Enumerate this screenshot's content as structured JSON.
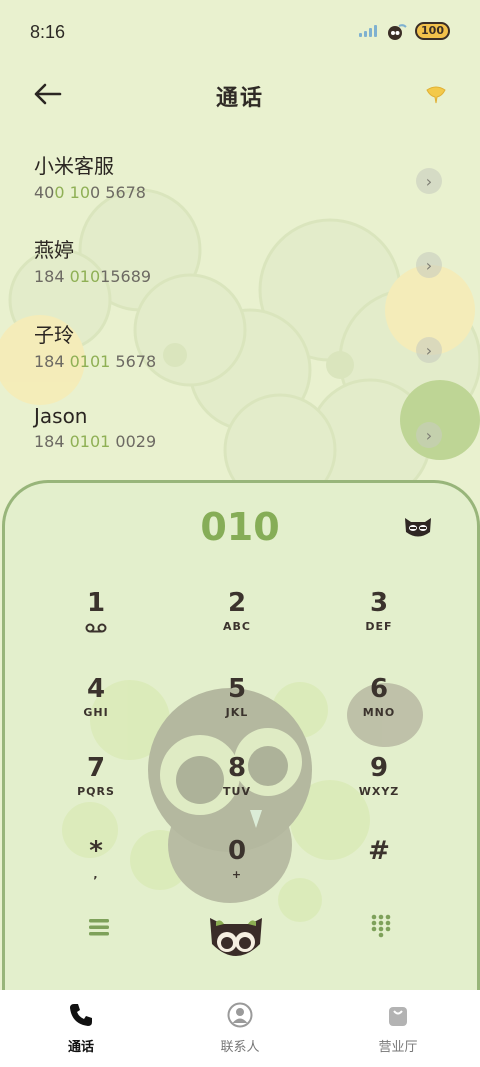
{
  "status_bar": {
    "time": "8:16",
    "battery": "100"
  },
  "header": {
    "title": "通话"
  },
  "contacts": [
    {
      "name": "小米客服",
      "number_parts": [
        "40",
        "0",
        " ",
        "10",
        "0 5678"
      ]
    },
    {
      "name": "燕婷",
      "number_parts": [
        "184 ",
        "010",
        "15689"
      ]
    },
    {
      "name": "子玲",
      "number_parts": [
        "184 ",
        "0101",
        " 5678"
      ]
    },
    {
      "name": "Jason",
      "number_parts": [
        "184 ",
        "0101",
        " 0029"
      ]
    }
  ],
  "dialer": {
    "input_value": "010",
    "keys": [
      {
        "digit": "1",
        "letters": ""
      },
      {
        "digit": "2",
        "letters": "ABC"
      },
      {
        "digit": "3",
        "letters": "DEF"
      },
      {
        "digit": "4",
        "letters": "GHI"
      },
      {
        "digit": "5",
        "letters": "JKL"
      },
      {
        "digit": "6",
        "letters": "MNO"
      },
      {
        "digit": "7",
        "letters": "PQRS"
      },
      {
        "digit": "8",
        "letters": "TUV"
      },
      {
        "digit": "9",
        "letters": "WXYZ"
      },
      {
        "digit": "*",
        "letters": ","
      },
      {
        "digit": "0",
        "letters": "+"
      },
      {
        "digit": "#",
        "letters": ""
      }
    ]
  },
  "bottom_nav": [
    {
      "label": "通话",
      "icon": "phone-icon",
      "active": true
    },
    {
      "label": "联系人",
      "icon": "person-icon",
      "active": false
    },
    {
      "label": "营业厅",
      "icon": "bag-icon",
      "active": false
    }
  ],
  "colors": {
    "background": "#e9f1cf",
    "accent": "#86ad57",
    "text": "#2f2a26"
  }
}
